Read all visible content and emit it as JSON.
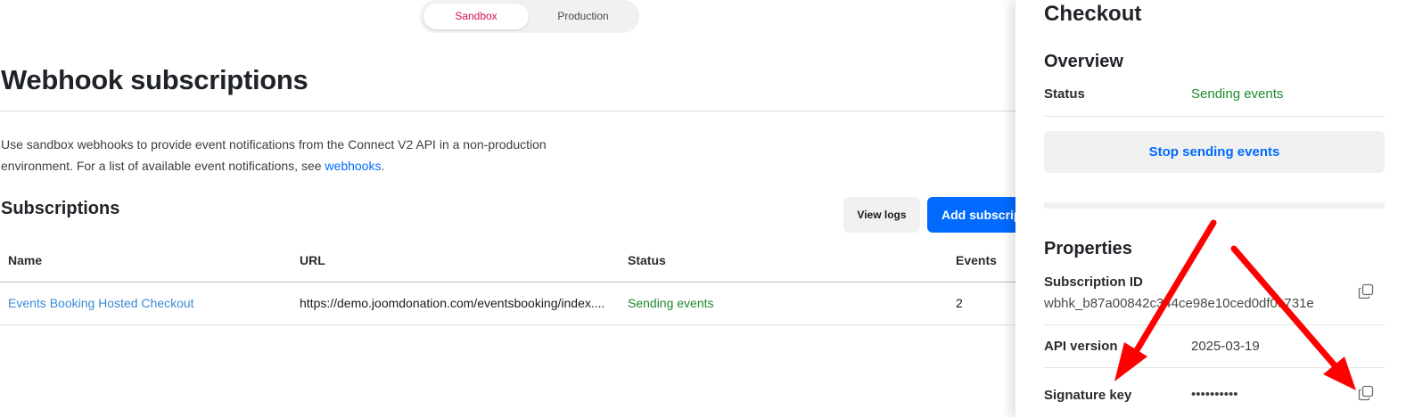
{
  "env_toggle": {
    "sandbox": "Sandbox",
    "production": "Production"
  },
  "page_title": "Webhook subscriptions",
  "description": {
    "text": "Use sandbox webhooks to provide event notifications from the Connect V2 API in a non-production environment. For a list of available event notifications, see ",
    "link": "webhooks",
    "suffix": "."
  },
  "subscriptions": {
    "title": "Subscriptions",
    "view_logs": "View logs",
    "add_button": "Add subscription",
    "columns": [
      "Name",
      "URL",
      "Status",
      "Events"
    ],
    "rows": [
      {
        "name": "Events Booking Hosted Checkout",
        "url": "https://demo.joomdonation.com/eventsbooking/index....",
        "status": "Sending events",
        "events": "2"
      }
    ]
  },
  "panel": {
    "title": "Checkout",
    "overview_title": "Overview",
    "status_label": "Status",
    "status_value": "Sending events",
    "stop_button": "Stop sending events",
    "properties_title": "Properties",
    "subscription_id_label": "Subscription ID",
    "subscription_id_value": "wbhk_b87a00842c344ce98e10ced0df0c731e",
    "api_version_label": "API version",
    "api_version_value": "2025-03-19",
    "signature_key_label": "Signature key",
    "signature_key_value": "••••••••••"
  },
  "colors": {
    "accent": "#006aff",
    "sandbox_accent": "#d6124f",
    "success": "#1c8a2b",
    "annotation_arrow": "#ff0000"
  },
  "icons": [
    "copy-icon"
  ]
}
